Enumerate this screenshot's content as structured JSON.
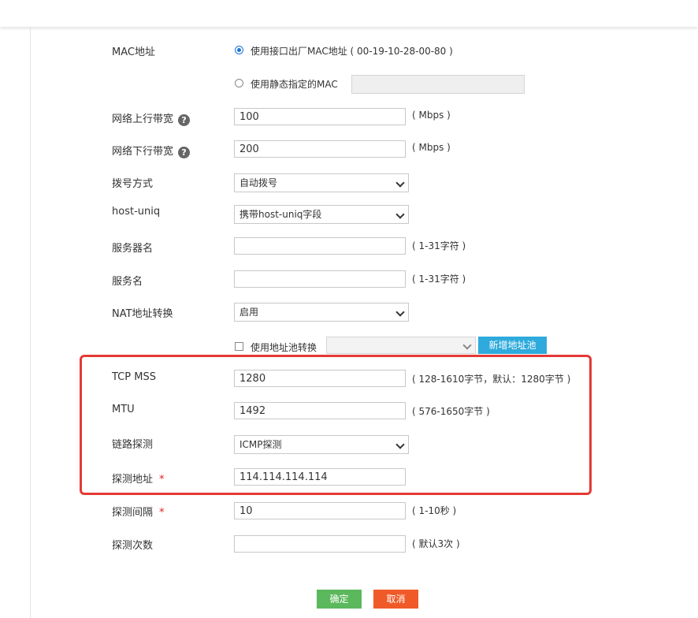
{
  "mac": {
    "label": "MAC地址",
    "opt_interface": "使用接口出厂MAC地址 ( 00-19-10-28-00-80 )",
    "opt_static": "使用静态指定的MAC",
    "static_value": ""
  },
  "upstream": {
    "label": "网络上行带宽",
    "value": "100",
    "hint": "( Mbps )"
  },
  "downstream": {
    "label": "网络下行带宽",
    "value": "200",
    "hint": "( Mbps )"
  },
  "dial": {
    "label": "拨号方式",
    "selected": "自动拨号"
  },
  "hostuniq": {
    "label": "host-uniq",
    "selected": "携带host-uniq字段"
  },
  "server_name": {
    "label": "服务器名",
    "value": "",
    "hint": "( 1-31字符 )"
  },
  "service_name": {
    "label": "服务名",
    "value": "",
    "hint": "( 1-31字符 )"
  },
  "nat": {
    "label": "NAT地址转换",
    "selected": "启用",
    "pool_checkbox": "使用地址池转换",
    "pool_selected": "",
    "add_pool_button": "新增地址池"
  },
  "tcp_mss": {
    "label": "TCP MSS",
    "value": "1280",
    "hint": "( 128-1610字节，默认：1280字节 )"
  },
  "mtu": {
    "label": "MTU",
    "value": "1492",
    "hint": "( 576-1650字节 )"
  },
  "link_detect": {
    "label": "链路探测",
    "selected": "ICMP探测"
  },
  "detect_addr": {
    "label": "探测地址",
    "required": "*",
    "value": "114.114.114.114"
  },
  "detect_interval": {
    "label": "探测间隔",
    "required": "*",
    "value": "10",
    "hint": "( 1-10秒 )"
  },
  "detect_count": {
    "label": "探测次数",
    "value": "",
    "hint": "( 默认3次 )"
  },
  "buttons": {
    "confirm": "确定",
    "cancel": "取消"
  },
  "icons": {
    "help": "question-circle-icon",
    "dropdown": "chevron-down-icon"
  },
  "colors": {
    "confirm_bg": "#5cb85c",
    "cancel_bg": "#f05a28",
    "add_pool_bg": "#2eaadc",
    "highlight_border": "#e53935",
    "required": "#e02020",
    "radio_on": "#1a73d9"
  }
}
